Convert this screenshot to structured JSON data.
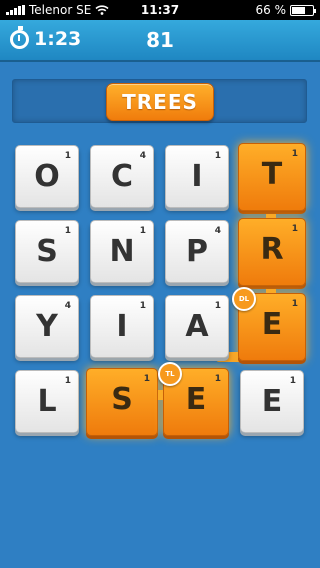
{
  "status_bar": {
    "carrier": "Telenor SE",
    "time": "11:37",
    "battery": "66 %",
    "battery_level": 0.66
  },
  "header": {
    "timer": "1:23",
    "score": "81"
  },
  "current_word": "TREES",
  "board": {
    "rows": [
      [
        {
          "letter": "O",
          "points": "1",
          "selected": false
        },
        {
          "letter": "C",
          "points": "4",
          "selected": false
        },
        {
          "letter": "I",
          "points": "1",
          "selected": false
        },
        {
          "letter": "T",
          "points": "1",
          "selected": true
        }
      ],
      [
        {
          "letter": "S",
          "points": "1",
          "selected": false
        },
        {
          "letter": "N",
          "points": "1",
          "selected": false
        },
        {
          "letter": "P",
          "points": "4",
          "selected": false
        },
        {
          "letter": "R",
          "points": "1",
          "selected": true
        }
      ],
      [
        {
          "letter": "Y",
          "points": "4",
          "selected": false
        },
        {
          "letter": "I",
          "points": "1",
          "selected": false
        },
        {
          "letter": "A",
          "points": "1",
          "selected": false
        },
        {
          "letter": "E",
          "points": "1",
          "selected": true
        }
      ],
      [
        {
          "letter": "L",
          "points": "1",
          "selected": false
        },
        {
          "letter": "S",
          "points": "1",
          "selected": true
        },
        {
          "letter": "E",
          "points": "1",
          "selected": true
        },
        {
          "letter": "E",
          "points": "1",
          "selected": false
        }
      ]
    ],
    "bonuses": [
      {
        "label": "DL"
      },
      {
        "label": "TL"
      }
    ]
  }
}
